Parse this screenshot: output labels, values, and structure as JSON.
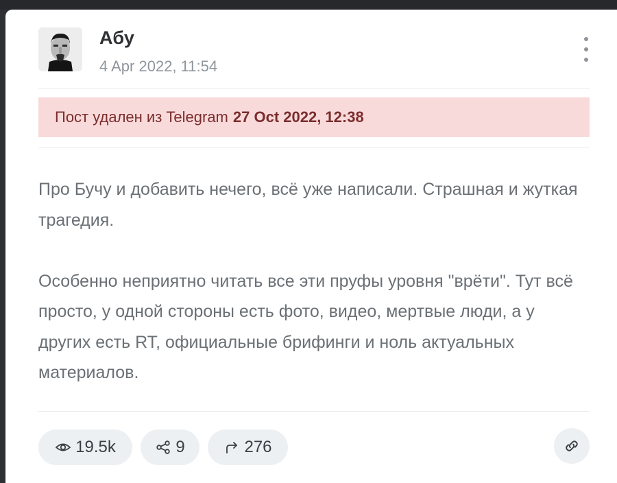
{
  "post": {
    "author": "Абу",
    "date": "4 Apr 2022, 11:54",
    "deleted_notice": {
      "text": "Пост удален из Telegram",
      "date": "27 Oct 2022, 12:38"
    },
    "paragraphs": [
      "Про Бучу и добавить нечего, всё уже написали. Страшная и жуткая трагедия.",
      "Особенно неприятно читать все эти пруфы уровня \"врёти\". Тут всё просто, у одной стороны есть фото, видео, мертвые люди, а у других есть RT, официальные брифинги и ноль актуальных материалов."
    ]
  },
  "stats": {
    "views": "19.5k",
    "shares": "9",
    "forwards": "276"
  },
  "icons": {
    "avatar": "user-avatar",
    "menu": "kebab-menu-icon",
    "views": "eye-icon",
    "shares": "share-nodes-icon",
    "forwards": "forward-arrow-icon",
    "link": "link-icon"
  },
  "colors": {
    "alert_bg": "#f9dada",
    "alert_text": "#7a2d2d",
    "pill_bg": "#edf0f3",
    "text_muted": "#6b7075"
  }
}
